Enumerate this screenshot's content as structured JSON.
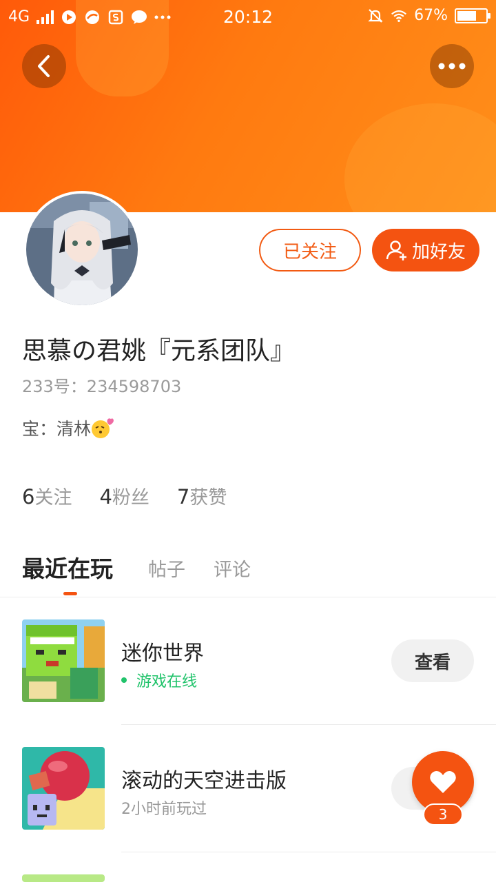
{
  "status_bar": {
    "network": "4G",
    "time": "20:12",
    "battery": "67%",
    "battery_level": 0.67
  },
  "profile": {
    "name": "思慕の君姚『元系团队』",
    "id_line": "233号：234598703",
    "bio": "宝：清林",
    "followed_label": "已关注",
    "add_friend_label": "加好友"
  },
  "stats": [
    {
      "count": "6",
      "label": "关注"
    },
    {
      "count": "4",
      "label": "粉丝"
    },
    {
      "count": "7",
      "label": "获赞"
    }
  ],
  "tabs": [
    {
      "label": "最近在玩",
      "active": true
    },
    {
      "label": "帖子",
      "active": false
    },
    {
      "label": "评论",
      "active": false
    }
  ],
  "games": [
    {
      "name": "迷你世界",
      "status": "游戏在线",
      "online": true,
      "action": "查看"
    },
    {
      "name": "滚动的天空进击版",
      "status": "2小时前玩过",
      "online": false,
      "action": "查看"
    }
  ],
  "fab": {
    "count": "3"
  },
  "icons": [
    "back-icon",
    "more-icon",
    "add-user-icon",
    "heart-icon",
    "wifi-icon",
    "mute-icon"
  ],
  "colors": {
    "accent": "#f45311",
    "online": "#21c36b"
  }
}
